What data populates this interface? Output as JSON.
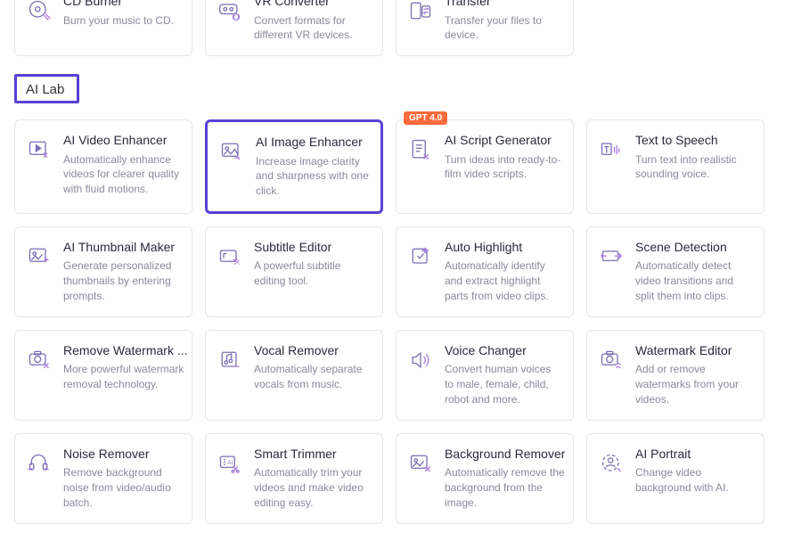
{
  "section_label": "AI Lab",
  "top_row": [
    {
      "title": "CD Burner",
      "desc": "Burn your music to CD."
    },
    {
      "title": "VR Converter",
      "desc": "Convert formats for different VR devices."
    },
    {
      "title": "Transfer",
      "desc": "Transfer your files to device."
    }
  ],
  "ai_lab": [
    {
      "title": "AI Video Enhancer",
      "desc": "Automatically enhance videos for clearer quality with fluid motions.",
      "badge": null
    },
    {
      "title": "AI Image Enhancer",
      "desc": "Increase image clarity and sharpness with one click.",
      "badge": null,
      "selected": true
    },
    {
      "title": "AI Script Generator",
      "desc": "Turn ideas into ready-to-film video scripts.",
      "badge": "GPT 4.0"
    },
    {
      "title": "Text to Speech",
      "desc": "Turn text into realistic sounding voice.",
      "badge": null
    },
    {
      "title": "AI Thumbnail Maker",
      "desc": "Generate personalized thumbnails by entering prompts.",
      "badge": null
    },
    {
      "title": "Subtitle Editor",
      "desc": "A powerful subtitle editing tool.",
      "badge": null
    },
    {
      "title": "Auto Highlight",
      "desc": "Automatically identify and extract highlight parts from video clips.",
      "badge": null
    },
    {
      "title": "Scene Detection",
      "desc": "Automatically detect video transitions and split them into clips.",
      "badge": null
    },
    {
      "title": "Remove Watermark ...",
      "desc": "More powerful watermark removal technology.",
      "badge": null
    },
    {
      "title": "Vocal Remover",
      "desc": "Automatically separate vocals from music.",
      "badge": null
    },
    {
      "title": "Voice Changer",
      "desc": "Convert human voices to male, female, child, robot and more.",
      "badge": null
    },
    {
      "title": "Watermark Editor",
      "desc": "Add or remove watermarks from your videos.",
      "badge": null
    },
    {
      "title": "Noise Remover",
      "desc": "Remove background noise from video/audio batch.",
      "badge": null
    },
    {
      "title": "Smart Trimmer",
      "desc": "Automatically trim your videos and make video editing easy.",
      "badge": null
    },
    {
      "title": "Background Remover",
      "desc": "Automatically remove the background from the image.",
      "badge": null
    },
    {
      "title": "AI Portrait",
      "desc": "Change video background with AI.",
      "badge": null
    }
  ],
  "icons": {
    "cd-burner-icon": "cd",
    "vr-converter-icon": "vr",
    "transfer-icon": "transfer",
    "ai-video-enhancer-icon": "video-spark",
    "ai-image-enhancer-icon": "image-spark",
    "ai-script-generator-icon": "script",
    "text-to-speech-icon": "tts",
    "ai-thumbnail-maker-icon": "thumb",
    "subtitle-editor-icon": "subtitle",
    "auto-highlight-icon": "highlight",
    "scene-detection-icon": "scene",
    "remove-watermark-icon": "camera-x",
    "vocal-remover-icon": "music-minus",
    "voice-changer-icon": "speaker",
    "watermark-editor-icon": "camera-wave",
    "noise-remover-icon": "headphones",
    "smart-trimmer-icon": "trim",
    "background-remover-icon": "bg-remove",
    "ai-portrait-icon": "portrait"
  },
  "colors": {
    "accent": "#5a3fd6",
    "badge": "#ff6a3d",
    "muted": "#8a8a99"
  }
}
